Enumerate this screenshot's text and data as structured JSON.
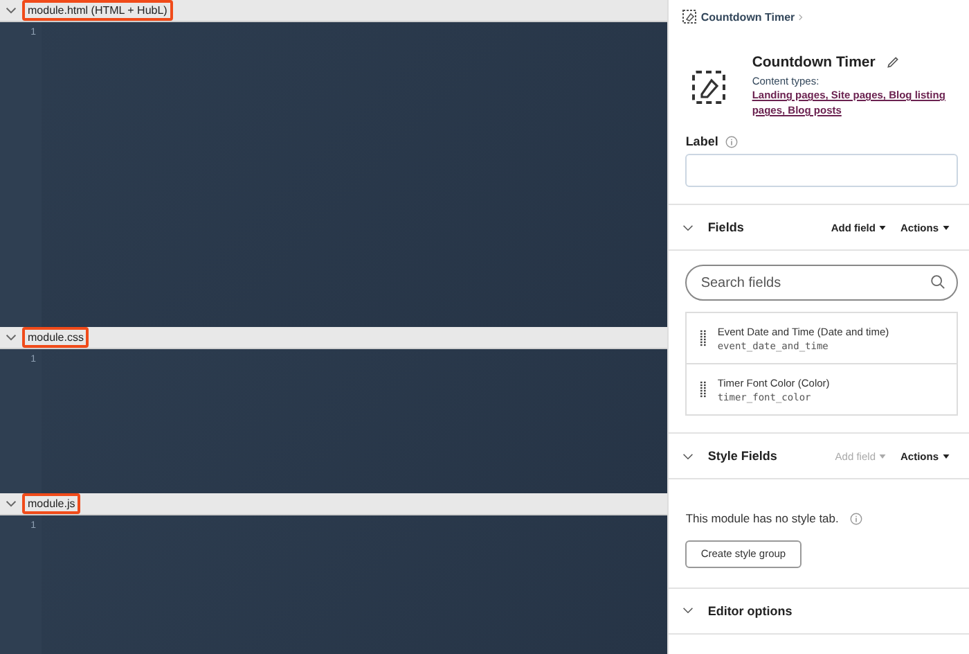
{
  "editors": [
    {
      "filename": "module.html (HTML + HubL)",
      "highlighted": true,
      "expanded": true,
      "line_numbers": [
        "1"
      ]
    },
    {
      "filename": "module.css",
      "highlighted": true,
      "expanded": true,
      "line_numbers": [
        "1"
      ]
    },
    {
      "filename": "module.js",
      "highlighted": true,
      "expanded": true,
      "line_numbers": [
        "1"
      ]
    }
  ],
  "sidebar": {
    "breadcrumb": "Countdown Timer",
    "module_name": "Countdown Timer",
    "content_types_label": "Content types:",
    "content_types": "Landing pages, Site pages, Blog listing pages, Blog posts",
    "label_field": {
      "label": "Label"
    },
    "fields_section": {
      "title": "Fields",
      "expanded": true,
      "add_field": {
        "label": "Add field",
        "disabled": false
      },
      "actions": "Actions",
      "search": {
        "placeholder": "Search fields"
      },
      "fields": [
        {
          "name": "Event Date and Time (Date and time)",
          "id": "event_date_and_time"
        },
        {
          "name": "Timer Font Color (Color)",
          "id": "timer_font_color"
        }
      ]
    },
    "style_section": {
      "title": "Style Fields",
      "expanded": true,
      "add_field": {
        "label": "Add field",
        "disabled": true
      },
      "actions": "Actions",
      "message": "This module has no style tab.",
      "button": "Create style group"
    },
    "editor_options": {
      "title": "Editor options"
    }
  }
}
